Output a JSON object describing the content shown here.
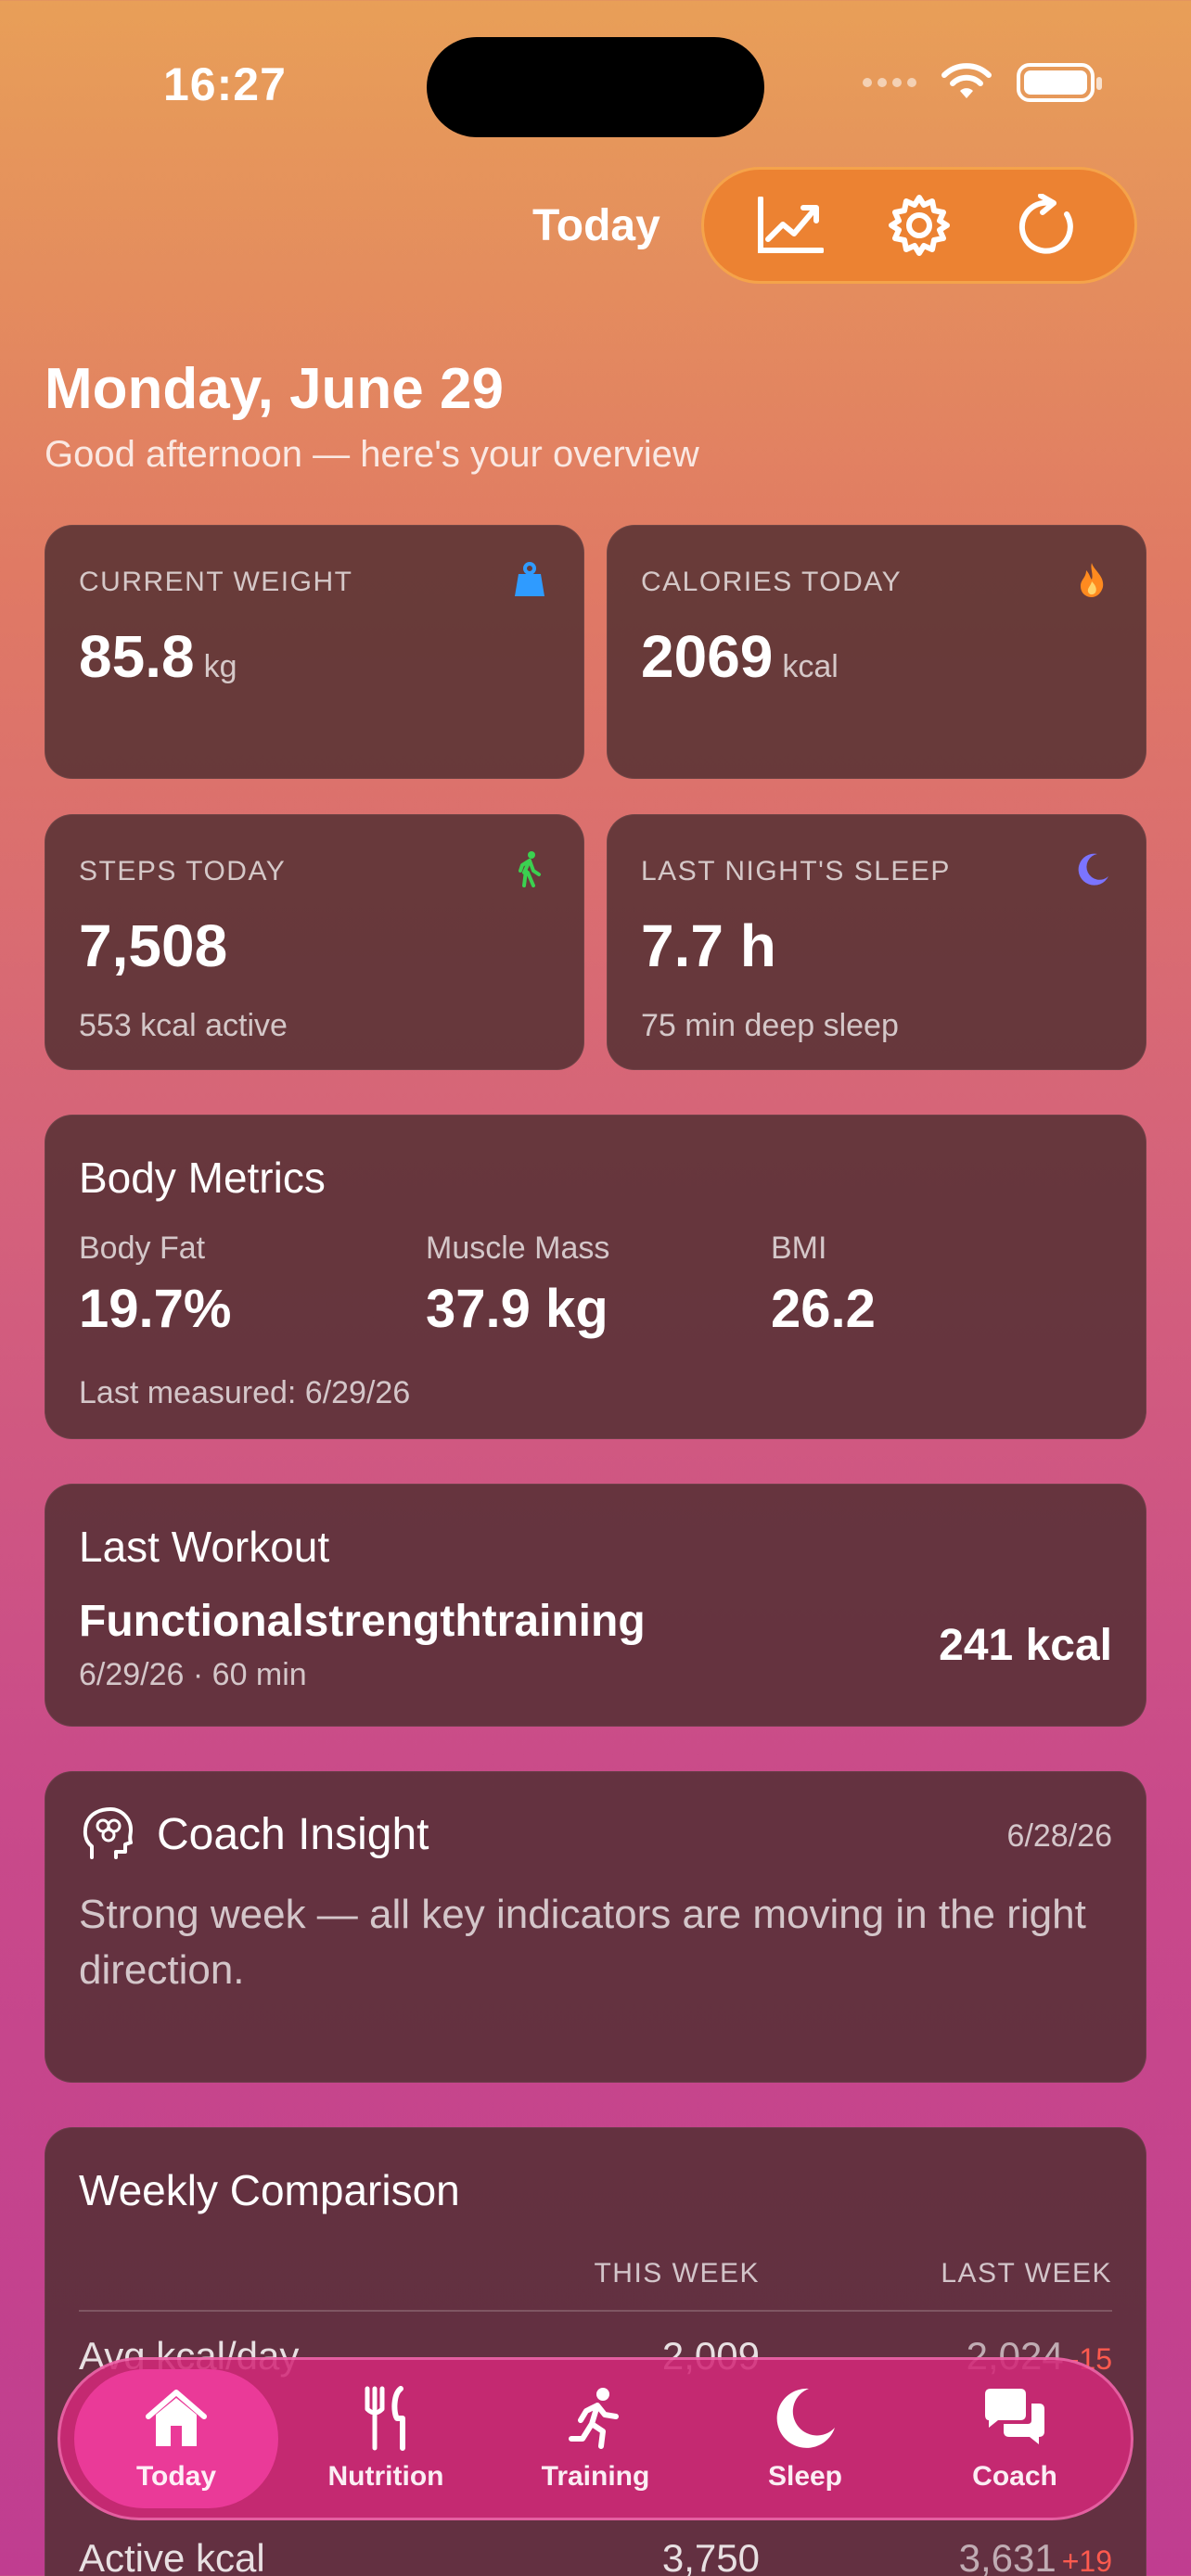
{
  "status": {
    "time": "16:27"
  },
  "nav": {
    "title": "Today",
    "buttons": [
      "chart-icon",
      "gear-icon",
      "refresh-icon"
    ]
  },
  "header": {
    "date": "Monday, June 29",
    "greeting": "Good afternoon — here's your overview"
  },
  "stats": {
    "weight": {
      "label": "CURRENT WEIGHT",
      "value": "85.8",
      "unit": "kg",
      "icon": "weight-icon",
      "color": "#2f9bff"
    },
    "calories": {
      "label": "CALORIES TODAY",
      "value": "2069",
      "unit": "kcal",
      "icon": "flame-icon",
      "color": "#ff8a1f"
    },
    "steps": {
      "label": "STEPS TODAY",
      "value": "7,508",
      "sub": "553 kcal active",
      "icon": "walk-icon",
      "color": "#3bd150"
    },
    "sleep": {
      "label": "LAST NIGHT'S SLEEP",
      "value": "7.7 h",
      "sub": "75 min deep sleep",
      "icon": "moon-icon",
      "color": "#7b74ff"
    }
  },
  "body_metrics": {
    "title": "Body Metrics",
    "items": [
      {
        "label": "Body Fat",
        "value": "19.7%"
      },
      {
        "label": "Muscle Mass",
        "value": "37.9 kg"
      },
      {
        "label": "BMI",
        "value": "26.2"
      }
    ],
    "last_measured": "Last measured: 6/29/26"
  },
  "last_workout": {
    "title": "Last Workout",
    "name": "Functionalstrengthtraining",
    "meta": "6/29/26 · 60 min",
    "kcal": "241 kcal"
  },
  "coach": {
    "title": "Coach Insight",
    "date": "6/28/26",
    "text": "Strong week — all key indicators are moving in the right direction."
  },
  "weekly": {
    "title": "Weekly Comparison",
    "col_this": "THIS WEEK",
    "col_last": "LAST WEEK",
    "rows": [
      {
        "label": "Avg kcal/day",
        "this": "2,009",
        "last": "2,024",
        "delta": "-15"
      },
      {
        "label": "Active kcal",
        "this": "3,750",
        "last": "3,631",
        "delta": "+19"
      }
    ]
  },
  "tabs": [
    {
      "label": "Today",
      "icon": "house-icon",
      "active": true
    },
    {
      "label": "Nutrition",
      "icon": "fork-knife-icon",
      "active": false
    },
    {
      "label": "Training",
      "icon": "runner-icon",
      "active": false
    },
    {
      "label": "Sleep",
      "icon": "moon-icon",
      "active": false
    },
    {
      "label": "Coach",
      "icon": "chat-bubbles-icon",
      "active": false
    }
  ]
}
